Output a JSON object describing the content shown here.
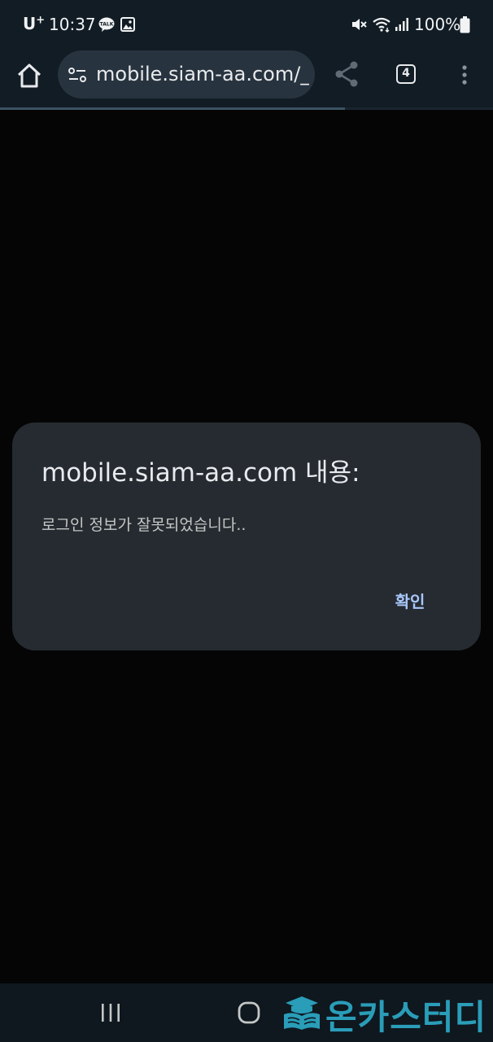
{
  "status_bar": {
    "carrier": "U",
    "carrier_super": "+",
    "time": "10:37",
    "battery": "100%",
    "icons": [
      "kakaotalk-icon",
      "gallery-icon",
      "mute-icon",
      "wifi-icon",
      "signal-icon",
      "battery-icon"
    ]
  },
  "toolbar": {
    "url": "mobile.siam-aa.com/_",
    "tab_count": "4",
    "page_load_progress": 0.7,
    "icons": [
      "home-icon",
      "site-settings-icon",
      "share-icon",
      "more-vert-icon"
    ]
  },
  "dialog": {
    "title": "mobile.siam-aa.com 내용:",
    "message": "로그인 정보가 잘못되었습니다..",
    "ok_label": "확인"
  },
  "nav_bar": {
    "icons": [
      "recent-apps-icon",
      "home-icon"
    ]
  },
  "watermark": {
    "text": "온카스터디"
  },
  "colors": {
    "toolbar_bg": "#121c25",
    "omnibox_bg": "#27333e",
    "dialog_bg": "#262b31",
    "accent": "#a8c7fa",
    "watermark": "#2a9db8"
  }
}
